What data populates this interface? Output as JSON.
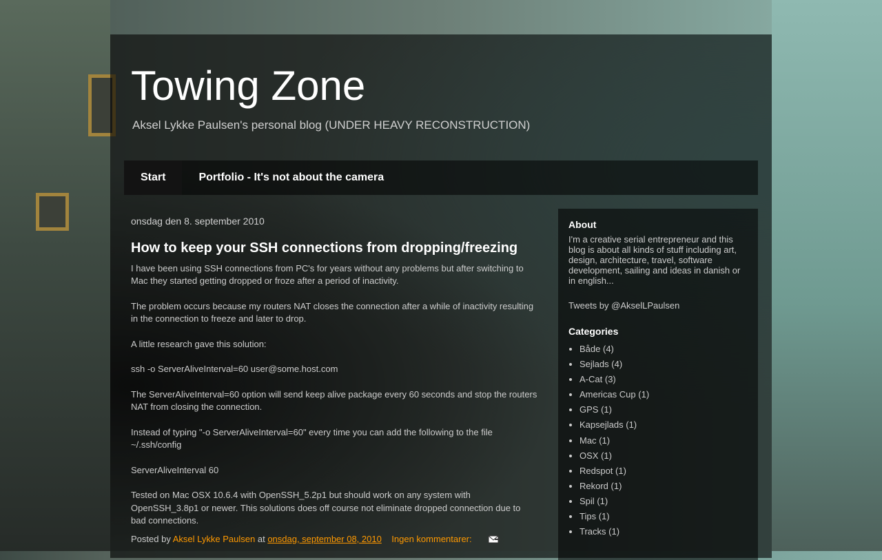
{
  "blog": {
    "title": "Towing Zone",
    "description": "Aksel Lykke Paulsen's personal blog (UNDER HEAVY RECONSTRUCTION)"
  },
  "tabs": [
    {
      "label": "Start",
      "active": true
    },
    {
      "label": "Portfolio - It's not about the camera",
      "active": false
    }
  ],
  "post": {
    "date_header": "onsdag den 8. september 2010",
    "title": "How to keep your SSH connections from dropping/freezing",
    "paragraphs": [
      "I have been using SSH connections from PC's for years without any problems but after switching to Mac they started getting dropped or froze after a period of inactivity.",
      "The problem occurs because my routers NAT closes the connection after a while of inactivity resulting in the connection to freeze and later to drop.",
      "A little research gave this solution:",
      "ssh -o ServerAliveInterval=60 user@some.host.com",
      "The ServerAliveInterval=60 option will send keep alive package every 60 seconds and stop the routers NAT from closing the connection.",
      "Instead of typing \"-o ServerAliveInterval=60\" every time you can add the following to the file ~/.ssh/config",
      "ServerAliveInterval 60",
      "Tested on Mac OSX 10.6.4 with OpenSSH_5.2p1 but should work on any system with OpenSSH_3.8p1 or newer. This solutions does off course not eliminate dropped connection due to bad connections."
    ],
    "footer": {
      "posted_by_label": "Posted by",
      "author": "Aksel Lykke Paulsen",
      "at_label": "at",
      "timestamp": "onsdag, september 08, 2010",
      "comments": "Ingen kommentarer:",
      "email_icon": "email-post-icon"
    }
  },
  "sidebar": {
    "about_title": "About",
    "about_text": "I'm a creative serial entrepreneur and this blog is about all kinds of stuff including art, design, architecture, travel, software development, sailing and ideas in danish or in english...",
    "tweets_label": "Tweets by @AkselLPaulsen",
    "categories_title": "Categories",
    "categories": [
      {
        "name": "Både",
        "count": "(4)"
      },
      {
        "name": "Sejlads",
        "count": "(4)"
      },
      {
        "name": "A-Cat",
        "count": "(3)"
      },
      {
        "name": "Americas Cup",
        "count": "(1)"
      },
      {
        "name": "GPS",
        "count": "(1)"
      },
      {
        "name": "Kapsejlads",
        "count": "(1)"
      },
      {
        "name": "Mac",
        "count": "(1)"
      },
      {
        "name": "OSX",
        "count": "(1)"
      },
      {
        "name": "Redspot",
        "count": "(1)"
      },
      {
        "name": "Rekord",
        "count": "(1)"
      },
      {
        "name": "Spil",
        "count": "(1)"
      },
      {
        "name": "Tips",
        "count": "(1)"
      },
      {
        "name": "Tracks",
        "count": "(1)"
      }
    ]
  },
  "colors": {
    "link": "#ff9900",
    "text": "#cccccc",
    "title": "#ffffff"
  }
}
